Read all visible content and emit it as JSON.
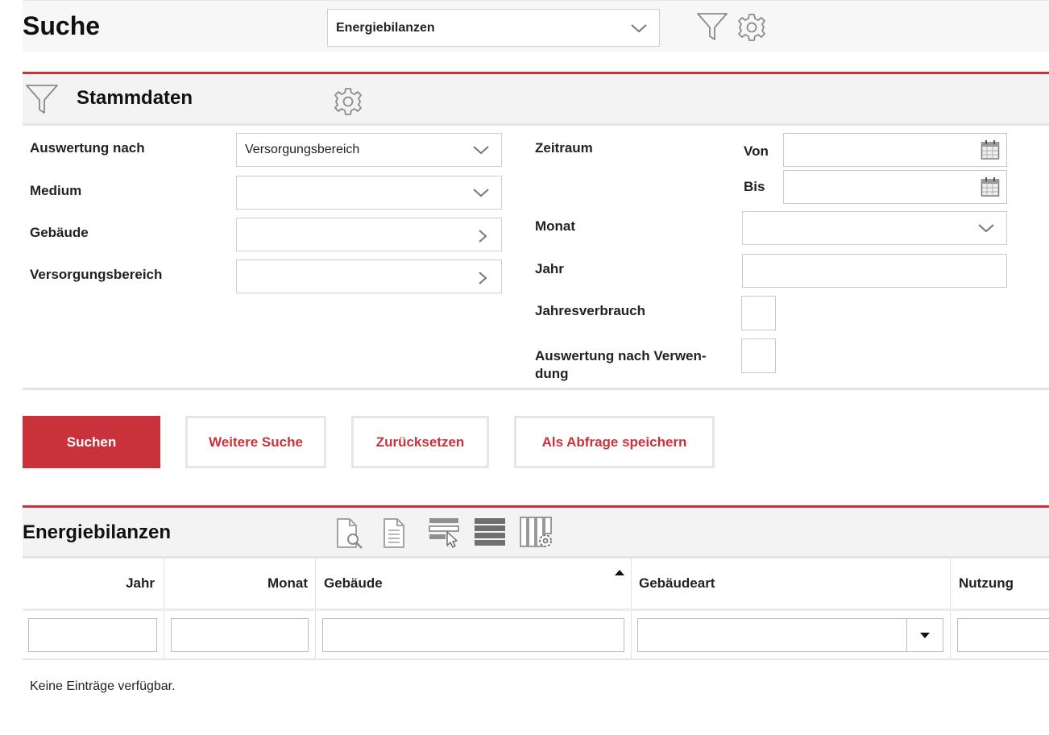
{
  "header": {
    "title": "Suche",
    "search_type": {
      "selected": "Energiebilanzen"
    },
    "filter_icon": "filter-icon",
    "settings_icon": "gear-icon"
  },
  "stammdaten": {
    "title": "Stammdaten",
    "left": {
      "auswertung_label": "Auswertung nach",
      "auswertung_value": "Versorgungsbereich",
      "medium_label": "Medium",
      "medium_value": "",
      "gebaeude_label": "Gebäude",
      "gebaeude_value": "",
      "versorgungsbereich_label": "Versorgungsbereich",
      "versorgungsbereich_value": ""
    },
    "right": {
      "zeitraum_label": "Zeitraum",
      "von_label": "Von",
      "von_value": "",
      "bis_label": "Bis",
      "bis_value": "",
      "monat_label": "Monat",
      "monat_value": "",
      "jahr_label": "Jahr",
      "jahr_value": "",
      "jahresverbrauch_label": "Jahresverbrauch",
      "jahresverbrauch_checked": false,
      "verwendung_label_line1": "Auswertung nach Verwen-",
      "verwendung_label_line2": "dung",
      "verwendung_checked": false
    }
  },
  "actions": {
    "search": "Suchen",
    "more_search": "Weitere Suche",
    "reset": "Zurücksetzen",
    "save_query": "Als Abfrage speichern"
  },
  "results": {
    "title": "Energiebilanzen",
    "toolbar_icons": [
      "preview-icon",
      "document-icon",
      "select-rows-icon",
      "rows-list-icon",
      "column-settings-icon"
    ],
    "columns": [
      "Jahr",
      "Monat",
      "Gebäude",
      "Gebäudeart",
      "Nutzung"
    ],
    "sorted_column": "Gebäude",
    "empty_message": "Keine Einträge verfügbar."
  },
  "colors": {
    "accent": "#c9323a",
    "band": "#f3f3f3",
    "border": "#c8c8c8"
  }
}
